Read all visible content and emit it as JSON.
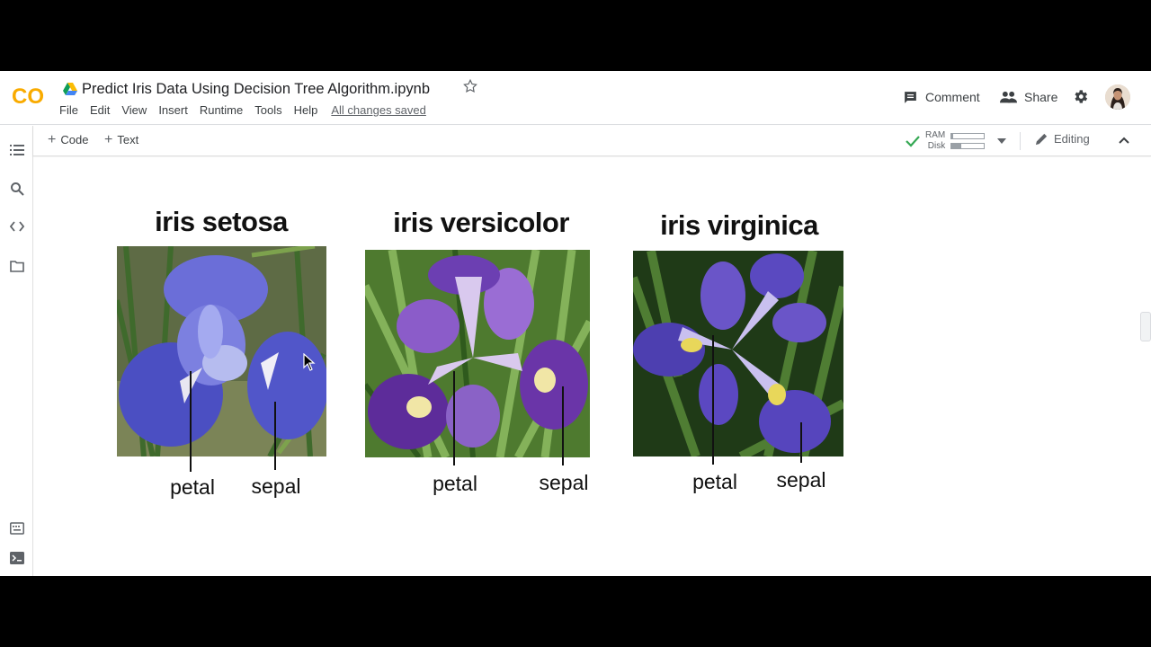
{
  "header": {
    "logo_text": "CO",
    "doc_title": "Predict Iris Data Using Decision Tree Algorithm.ipynb",
    "menu": [
      "File",
      "Edit",
      "View",
      "Insert",
      "Runtime",
      "Tools",
      "Help"
    ],
    "save_status": "All changes saved",
    "comment_label": "Comment",
    "share_label": "Share"
  },
  "toolbar": {
    "code_label": "Code",
    "text_label": "Text",
    "ram_label": "RAM",
    "disk_label": "Disk",
    "ram_usage": 0.05,
    "disk_usage": 0.3,
    "editing_label": "Editing"
  },
  "colors": {
    "logo_orange": "#F9AB00",
    "logo_amber": "#E8710A",
    "check_green": "#34A853"
  },
  "figure": {
    "flowers": [
      {
        "name": "iris setosa",
        "left_label": "petal",
        "right_label": "sepal"
      },
      {
        "name": "iris versicolor",
        "left_label": "petal",
        "right_label": "sepal"
      },
      {
        "name": "iris virginica",
        "left_label": "petal",
        "right_label": "sepal"
      }
    ]
  }
}
